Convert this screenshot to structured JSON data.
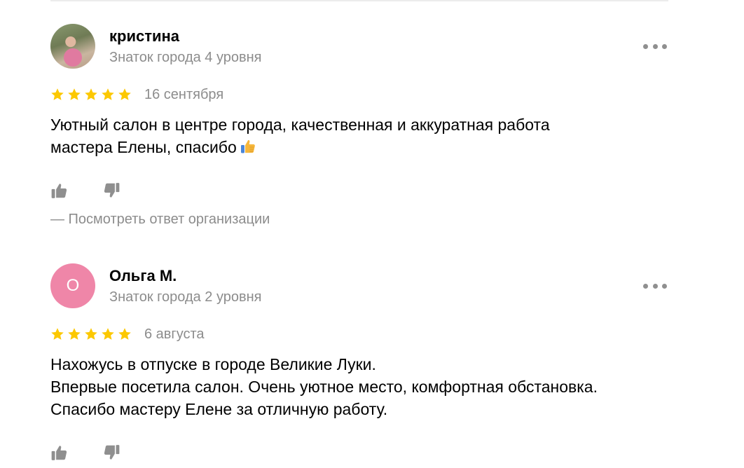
{
  "reviews": [
    {
      "author": "кристина",
      "level": "Знаток города 4 уровня",
      "avatar": {
        "type": "photo",
        "letter": ""
      },
      "rating": 5,
      "date": "16 сентября",
      "text_lines": [
        "Уютный салон в центре города, качественная и аккуратная работа",
        "мастера Елены, спасибо"
      ],
      "emoji": "thumbs-up-icon",
      "org_reply_link": "— Посмотреть ответ организации"
    },
    {
      "author": "Ольга М.",
      "level": "Знаток города 2 уровня",
      "avatar": {
        "type": "letter",
        "letter": "О",
        "color": "#ef86a8"
      },
      "rating": 5,
      "date": "6 августа",
      "text_lines": [
        "Нахожусь в отпуске в городе Великие Луки.",
        "Впервые посетила салон. Очень уютное место, комфортная обстановка.",
        "Спасибо мастеру Елене за отличную работу."
      ]
    }
  ],
  "colors": {
    "star": "#fcc800",
    "muted_text": "#8c8c8c",
    "icon_gray": "#8f8f8f",
    "divider": "#ececec"
  }
}
